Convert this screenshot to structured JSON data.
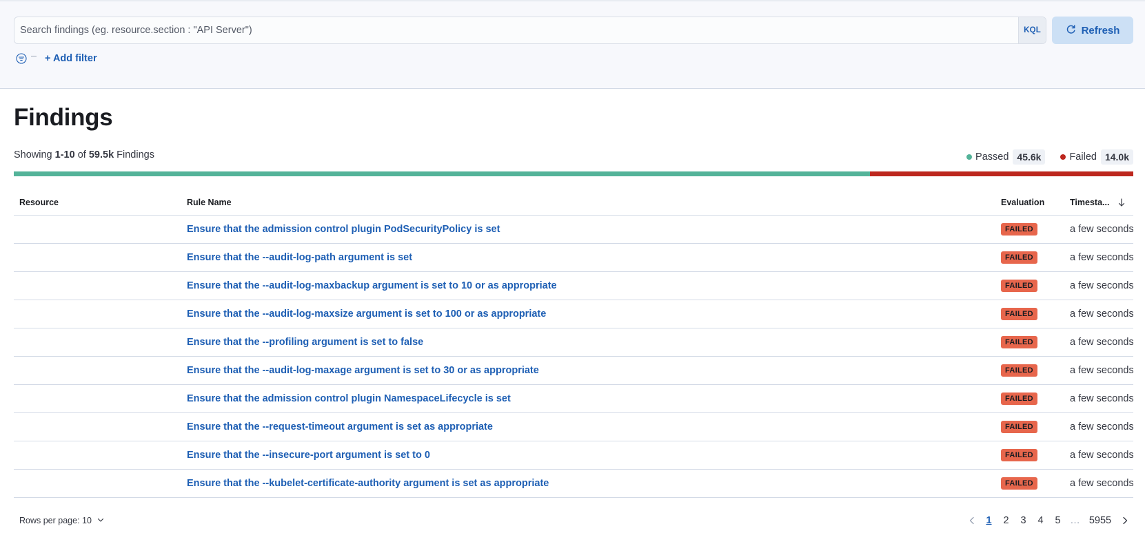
{
  "search": {
    "placeholder": "Search findings (eg. resource.section : \"API Server\")",
    "value": "",
    "language_button": "KQL"
  },
  "toolbar": {
    "refresh_label": "Refresh",
    "add_filter_label": "+ Add filter"
  },
  "page": {
    "title": "Findings"
  },
  "summary": {
    "prefix": "Showing ",
    "range": "1-10",
    "of": " of ",
    "total": "59.5k",
    "suffix": " Findings",
    "passed_label": "Passed",
    "passed_count": "45.6k",
    "failed_label": "Failed",
    "failed_count": "14.0k",
    "passed_fraction": 0.765
  },
  "colors": {
    "passed": "#54b399",
    "failed": "#bd271e",
    "failed_badge": "#e7664c",
    "link": "#1e5fb4"
  },
  "table": {
    "columns": {
      "resource": "Resource",
      "rule_name": "Rule Name",
      "evaluation": "Evaluation",
      "timestamp": "Timesta..."
    },
    "rows": [
      {
        "resource": "",
        "rule": "Ensure that the admission control plugin PodSecurityPolicy is set",
        "evaluation": "FAILED",
        "timestamp": "a few seconds ago"
      },
      {
        "resource": "",
        "rule": "Ensure that the --audit-log-path argument is set",
        "evaluation": "FAILED",
        "timestamp": "a few seconds ago"
      },
      {
        "resource": "",
        "rule": "Ensure that the --audit-log-maxbackup argument is set to 10 or as appropriate",
        "evaluation": "FAILED",
        "timestamp": "a few seconds ago"
      },
      {
        "resource": "",
        "rule": "Ensure that the --audit-log-maxsize argument is set to 100 or as appropriate",
        "evaluation": "FAILED",
        "timestamp": "a few seconds ago"
      },
      {
        "resource": "",
        "rule": "Ensure that the --profiling argument is set to false",
        "evaluation": "FAILED",
        "timestamp": "a few seconds ago"
      },
      {
        "resource": "",
        "rule": "Ensure that the --audit-log-maxage argument is set to 30 or as appropriate",
        "evaluation": "FAILED",
        "timestamp": "a few seconds ago"
      },
      {
        "resource": "",
        "rule": "Ensure that the admission control plugin NamespaceLifecycle is set",
        "evaluation": "FAILED",
        "timestamp": "a few seconds ago"
      },
      {
        "resource": "",
        "rule": "Ensure that the --request-timeout argument is set as appropriate",
        "evaluation": "FAILED",
        "timestamp": "a few seconds ago"
      },
      {
        "resource": "",
        "rule": "Ensure that the --insecure-port argument is set to 0",
        "evaluation": "FAILED",
        "timestamp": "a few seconds ago"
      },
      {
        "resource": "",
        "rule": "Ensure that the --kubelet-certificate-authority argument is set as appropriate",
        "evaluation": "FAILED",
        "timestamp": "a few seconds ago"
      }
    ]
  },
  "footer": {
    "rows_per_page": "Rows per page: 10",
    "pages": [
      "1",
      "2",
      "3",
      "4",
      "5"
    ],
    "ellipsis": "…",
    "last_page": "5955",
    "current_page": "1"
  },
  "icons": {
    "refresh": "refresh-icon",
    "filter": "filter-icon",
    "sort": "sort-descending-icon",
    "prev": "chevron-left-icon",
    "next": "chevron-right-icon",
    "dropdown": "chevron-down-icon"
  }
}
